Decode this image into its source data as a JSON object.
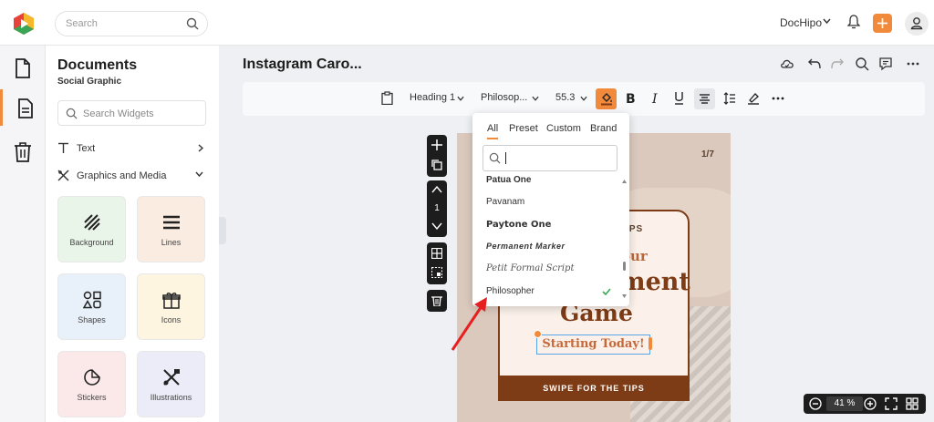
{
  "header": {
    "search_placeholder": "Search",
    "workspace": "DocHipo"
  },
  "panel": {
    "title": "Documents",
    "subtitle": "Social Graphic",
    "search_placeholder": "Search Widgets",
    "sections": [
      {
        "label": "Text"
      },
      {
        "label": "Graphics and Media"
      }
    ],
    "tiles": [
      {
        "label": "Background",
        "color": "#eaf5ea"
      },
      {
        "label": "Lines",
        "color": "#fbece2"
      },
      {
        "label": "Shapes",
        "color": "#e8f0fa"
      },
      {
        "label": "Icons",
        "color": "#fdf5e0"
      },
      {
        "label": "Stickers",
        "color": "#fbe9e9"
      },
      {
        "label": "Illustrations",
        "color": "#ebecf8"
      }
    ]
  },
  "editor": {
    "title": "Instagram Caro...",
    "toolbar": {
      "style": "Heading 1",
      "font": "Philosop...",
      "size": "55.3"
    },
    "page_number": "1"
  },
  "canvas": {
    "counter": "1/7",
    "tips": "TIPS",
    "line_your": "our",
    "line_ment": "ment",
    "line_game": "Game",
    "starting": "Starting Today!",
    "swipe": "SWIPE FOR THE TIPS"
  },
  "font_dropdown": {
    "tabs": [
      "All",
      "Preset",
      "Custom",
      "Brand"
    ],
    "fonts": [
      "Patua One",
      "Pavanam",
      "Paytone One",
      "Permanent Marker",
      "Petit Formal Script",
      "Philosopher"
    ],
    "selected": "Philosopher"
  },
  "zoom": {
    "value": "41 %"
  },
  "colors": {
    "accent": "#f28a3c",
    "brown": "#7d3b16"
  }
}
